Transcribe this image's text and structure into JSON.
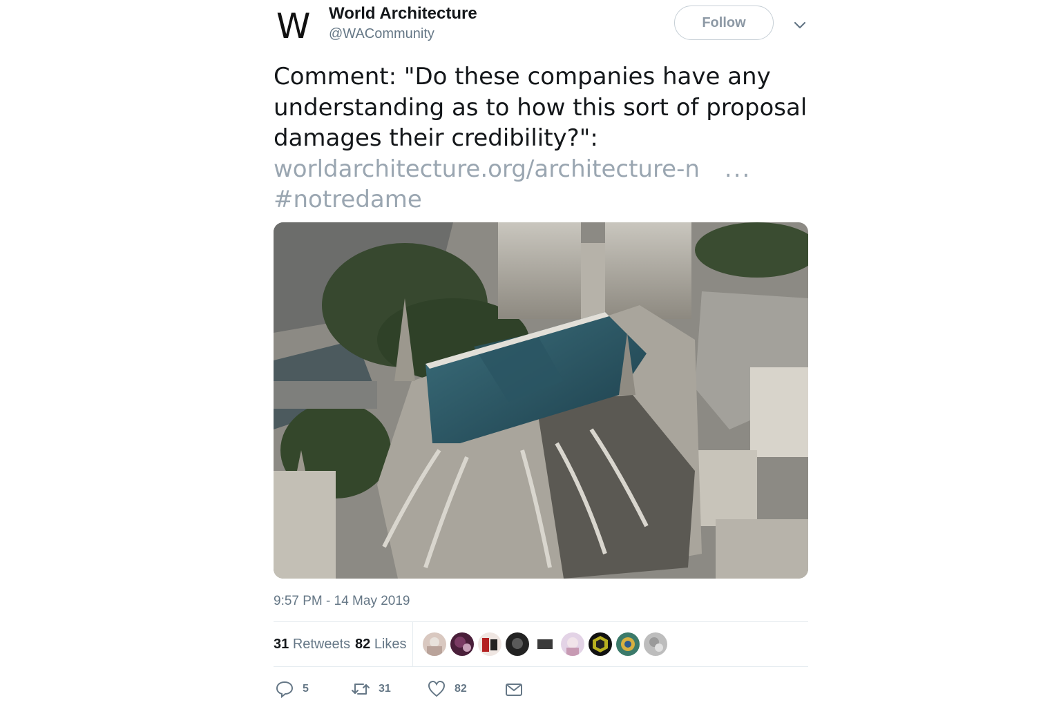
{
  "account": {
    "logo": "W",
    "name": "World Architecture",
    "handle": "@WACommunity",
    "follow_label": "Follow"
  },
  "tweet": {
    "text_lines": [
      "Comment: \"Do these companies have any",
      "understanding as to how this sort of proposal",
      "damages their credibility?\":"
    ],
    "link": "worldarchitecture.org/architecture-n",
    "link_ellipsis": "...",
    "hashtag": "#notredame",
    "timestamp": "9:57 PM - 14 May 2019"
  },
  "stats": {
    "retweets_count": "31",
    "retweets_label": "Retweets",
    "likes_count": "82",
    "likes_label": "Likes"
  },
  "actions": {
    "replies": "5",
    "retweets": "31",
    "likes": "82"
  },
  "icons": [
    "caret-down-icon",
    "reply-icon",
    "retweet-icon",
    "heart-icon",
    "mail-icon"
  ],
  "colors": {
    "text": "#14171a",
    "secondary": "#657786",
    "link": "#9aa6b1",
    "divider": "#e6ecf0"
  }
}
